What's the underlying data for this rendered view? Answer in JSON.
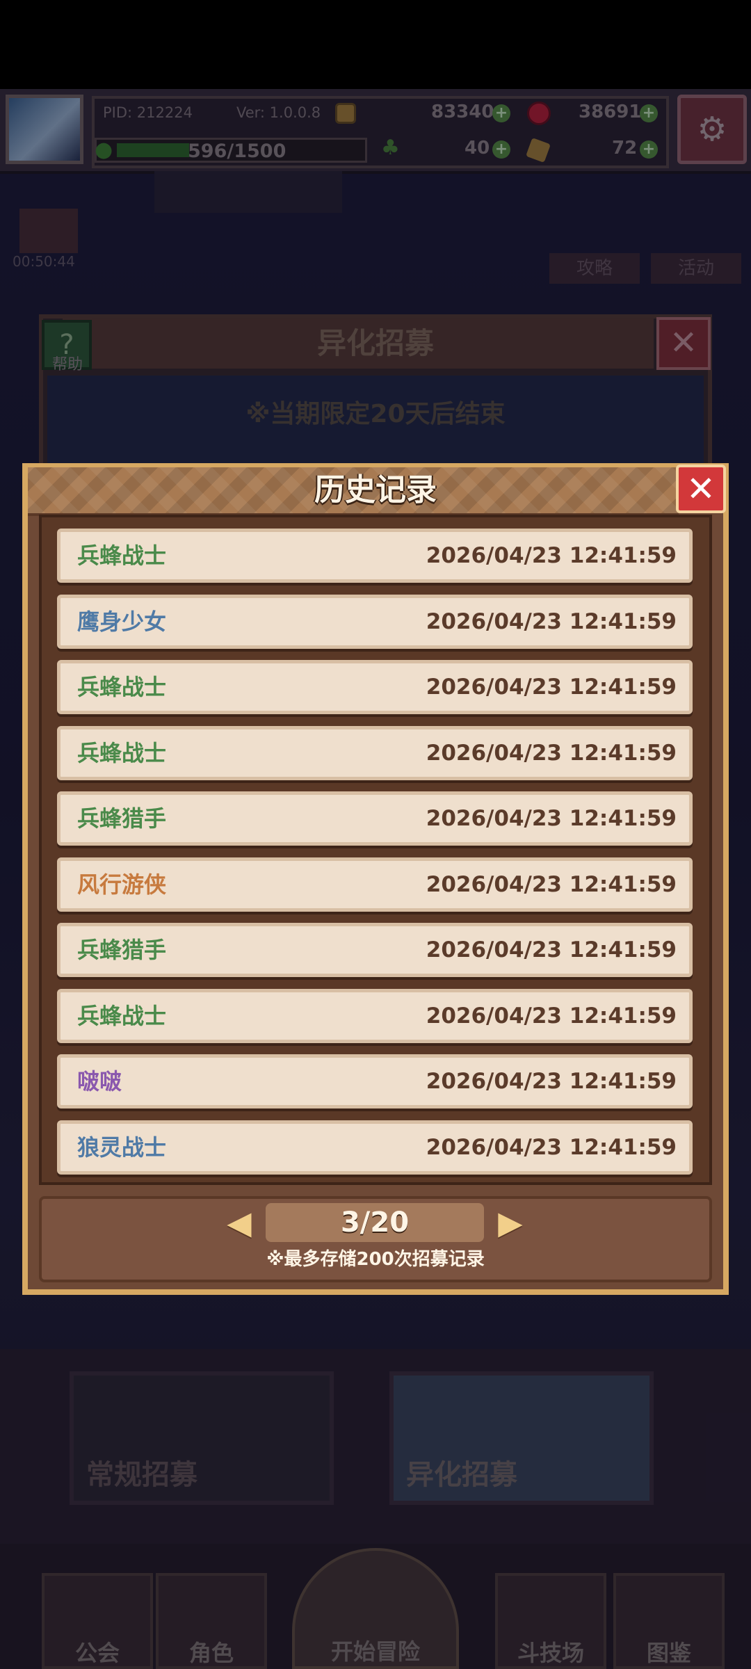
{
  "hud": {
    "pid": "PID: 212224",
    "version": "Ver: 1.0.0.8",
    "gold": "83340",
    "gems": "38691",
    "exp": "596/1500",
    "clover_count": "40",
    "key_count": "72",
    "timer": "00:50:44"
  },
  "background": {
    "events": [
      "攻略",
      "活动"
    ],
    "recruit_title": "异化招募",
    "help_label": "帮助",
    "limit_note": "※当期限定20天后结束",
    "lower_tabs": [
      "常规招募",
      "异化招募"
    ],
    "bottom_nav": [
      "公会",
      "角色",
      "开始冒险",
      "斗技场",
      "图鉴"
    ]
  },
  "history": {
    "title": "历史记录",
    "rows": [
      {
        "name": "兵蜂战士",
        "time": "2026/04/23 12:41:59",
        "color": "#4a8a4a"
      },
      {
        "name": "鹰身少女",
        "time": "2026/04/23 12:41:59",
        "color": "#4f7aa6"
      },
      {
        "name": "兵蜂战士",
        "time": "2026/04/23 12:41:59",
        "color": "#4a8a4a"
      },
      {
        "name": "兵蜂战士",
        "time": "2026/04/23 12:41:59",
        "color": "#4a8a4a"
      },
      {
        "name": "兵蜂猎手",
        "time": "2026/04/23 12:41:59",
        "color": "#4a8a4a"
      },
      {
        "name": "风行游侠",
        "time": "2026/04/23 12:41:59",
        "color": "#c77a3e"
      },
      {
        "name": "兵蜂猎手",
        "time": "2026/04/23 12:41:59",
        "color": "#4a8a4a"
      },
      {
        "name": "兵蜂战士",
        "time": "2026/04/23 12:41:59",
        "color": "#4a8a4a"
      },
      {
        "name": "啵啵",
        "time": "2026/04/23 12:41:59",
        "color": "#8a58ae"
      },
      {
        "name": "狼灵战士",
        "time": "2026/04/23 12:41:59",
        "color": "#4f7aa6"
      }
    ],
    "page": "3/20",
    "note": "※最多存储200次招募记录"
  }
}
